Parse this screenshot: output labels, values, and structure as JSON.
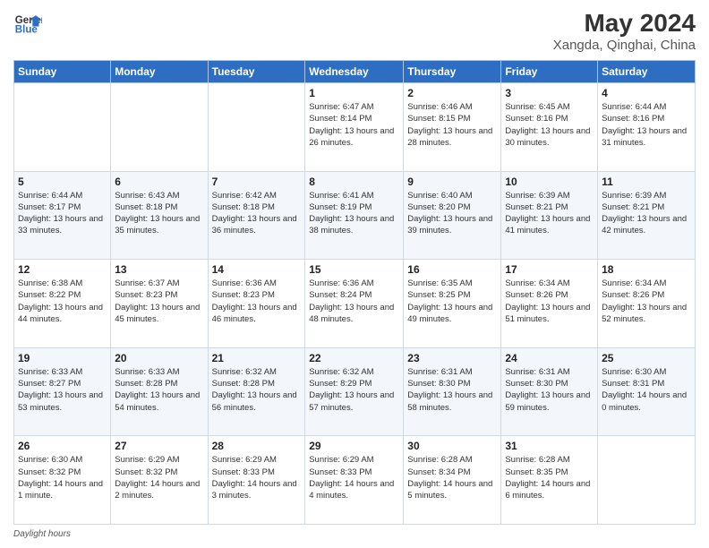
{
  "header": {
    "logo_line1": "General",
    "logo_line2": "Blue",
    "title": "May 2024",
    "subtitle": "Xangda, Qinghai, China"
  },
  "calendar": {
    "days_of_week": [
      "Sunday",
      "Monday",
      "Tuesday",
      "Wednesday",
      "Thursday",
      "Friday",
      "Saturday"
    ],
    "weeks": [
      [
        {
          "day": "",
          "info": ""
        },
        {
          "day": "",
          "info": ""
        },
        {
          "day": "",
          "info": ""
        },
        {
          "day": "1",
          "info": "Sunrise: 6:47 AM\nSunset: 8:14 PM\nDaylight: 13 hours\nand 26 minutes."
        },
        {
          "day": "2",
          "info": "Sunrise: 6:46 AM\nSunset: 8:15 PM\nDaylight: 13 hours\nand 28 minutes."
        },
        {
          "day": "3",
          "info": "Sunrise: 6:45 AM\nSunset: 8:16 PM\nDaylight: 13 hours\nand 30 minutes."
        },
        {
          "day": "4",
          "info": "Sunrise: 6:44 AM\nSunset: 8:16 PM\nDaylight: 13 hours\nand 31 minutes."
        }
      ],
      [
        {
          "day": "5",
          "info": "Sunrise: 6:44 AM\nSunset: 8:17 PM\nDaylight: 13 hours\nand 33 minutes."
        },
        {
          "day": "6",
          "info": "Sunrise: 6:43 AM\nSunset: 8:18 PM\nDaylight: 13 hours\nand 35 minutes."
        },
        {
          "day": "7",
          "info": "Sunrise: 6:42 AM\nSunset: 8:18 PM\nDaylight: 13 hours\nand 36 minutes."
        },
        {
          "day": "8",
          "info": "Sunrise: 6:41 AM\nSunset: 8:19 PM\nDaylight: 13 hours\nand 38 minutes."
        },
        {
          "day": "9",
          "info": "Sunrise: 6:40 AM\nSunset: 8:20 PM\nDaylight: 13 hours\nand 39 minutes."
        },
        {
          "day": "10",
          "info": "Sunrise: 6:39 AM\nSunset: 8:21 PM\nDaylight: 13 hours\nand 41 minutes."
        },
        {
          "day": "11",
          "info": "Sunrise: 6:39 AM\nSunset: 8:21 PM\nDaylight: 13 hours\nand 42 minutes."
        }
      ],
      [
        {
          "day": "12",
          "info": "Sunrise: 6:38 AM\nSunset: 8:22 PM\nDaylight: 13 hours\nand 44 minutes."
        },
        {
          "day": "13",
          "info": "Sunrise: 6:37 AM\nSunset: 8:23 PM\nDaylight: 13 hours\nand 45 minutes."
        },
        {
          "day": "14",
          "info": "Sunrise: 6:36 AM\nSunset: 8:23 PM\nDaylight: 13 hours\nand 46 minutes."
        },
        {
          "day": "15",
          "info": "Sunrise: 6:36 AM\nSunset: 8:24 PM\nDaylight: 13 hours\nand 48 minutes."
        },
        {
          "day": "16",
          "info": "Sunrise: 6:35 AM\nSunset: 8:25 PM\nDaylight: 13 hours\nand 49 minutes."
        },
        {
          "day": "17",
          "info": "Sunrise: 6:34 AM\nSunset: 8:26 PM\nDaylight: 13 hours\nand 51 minutes."
        },
        {
          "day": "18",
          "info": "Sunrise: 6:34 AM\nSunset: 8:26 PM\nDaylight: 13 hours\nand 52 minutes."
        }
      ],
      [
        {
          "day": "19",
          "info": "Sunrise: 6:33 AM\nSunset: 8:27 PM\nDaylight: 13 hours\nand 53 minutes."
        },
        {
          "day": "20",
          "info": "Sunrise: 6:33 AM\nSunset: 8:28 PM\nDaylight: 13 hours\nand 54 minutes."
        },
        {
          "day": "21",
          "info": "Sunrise: 6:32 AM\nSunset: 8:28 PM\nDaylight: 13 hours\nand 56 minutes."
        },
        {
          "day": "22",
          "info": "Sunrise: 6:32 AM\nSunset: 8:29 PM\nDaylight: 13 hours\nand 57 minutes."
        },
        {
          "day": "23",
          "info": "Sunrise: 6:31 AM\nSunset: 8:30 PM\nDaylight: 13 hours\nand 58 minutes."
        },
        {
          "day": "24",
          "info": "Sunrise: 6:31 AM\nSunset: 8:30 PM\nDaylight: 13 hours\nand 59 minutes."
        },
        {
          "day": "25",
          "info": "Sunrise: 6:30 AM\nSunset: 8:31 PM\nDaylight: 14 hours\nand 0 minutes."
        }
      ],
      [
        {
          "day": "26",
          "info": "Sunrise: 6:30 AM\nSunset: 8:32 PM\nDaylight: 14 hours\nand 1 minute."
        },
        {
          "day": "27",
          "info": "Sunrise: 6:29 AM\nSunset: 8:32 PM\nDaylight: 14 hours\nand 2 minutes."
        },
        {
          "day": "28",
          "info": "Sunrise: 6:29 AM\nSunset: 8:33 PM\nDaylight: 14 hours\nand 3 minutes."
        },
        {
          "day": "29",
          "info": "Sunrise: 6:29 AM\nSunset: 8:33 PM\nDaylight: 14 hours\nand 4 minutes."
        },
        {
          "day": "30",
          "info": "Sunrise: 6:28 AM\nSunset: 8:34 PM\nDaylight: 14 hours\nand 5 minutes."
        },
        {
          "day": "31",
          "info": "Sunrise: 6:28 AM\nSunset: 8:35 PM\nDaylight: 14 hours\nand 6 minutes."
        },
        {
          "day": "",
          "info": ""
        }
      ]
    ]
  },
  "footer": {
    "label": "Daylight hours"
  }
}
